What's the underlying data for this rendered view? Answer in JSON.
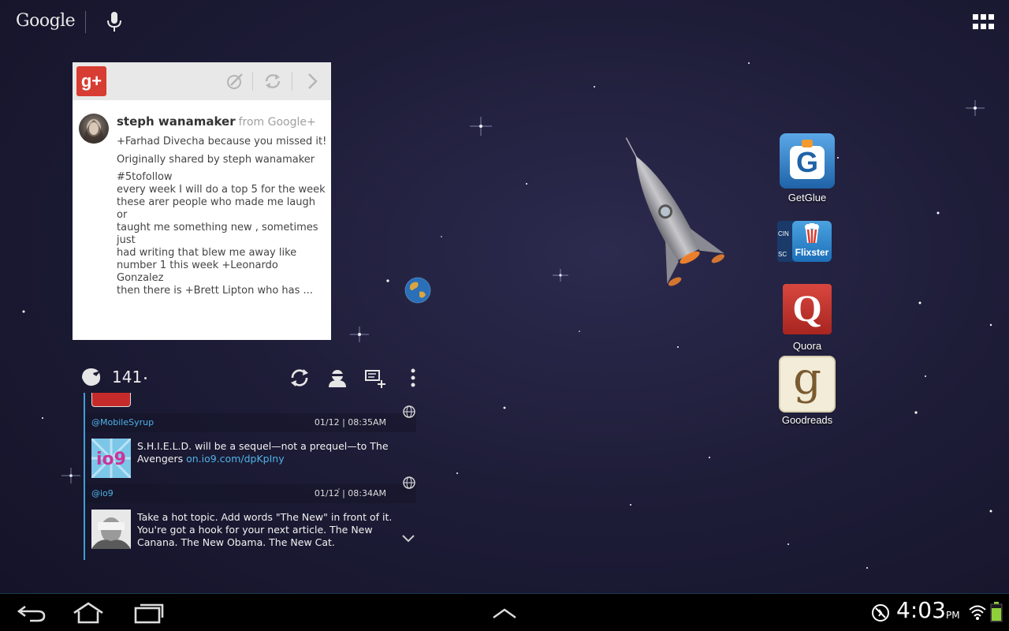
{
  "search_bar": {
    "logo_text": "Google"
  },
  "gplus_widget": {
    "logo_text": "g+",
    "author": "steph wanamaker",
    "source": "from Google+",
    "mention_line": "+Farhad Divecha because you missed it!",
    "shared_line": "Originally shared by steph wanamaker",
    "body": "#5tofollow\nevery  week I will do a  top 5 for the week\n these arer people who made me laugh or\ntaught me something new , sometimes just\nhad writing that blew me away  like\n number 1 this week  +Leonardo Gonzalez\nthen there is +Brett Lipton  who has ..."
  },
  "twitter_widget": {
    "count": "141",
    "tweets": [
      {
        "handle": "@MobileSyrup",
        "time": "01/12 | 08:35AM",
        "avatar_text": "io9",
        "text": "S.H.I.E.L.D. will be a sequel—not a prequel—to The Avengers ",
        "link": "on.io9.com/dpKpIny"
      },
      {
        "handle": "@io9",
        "time": "01/12 | 08:34AM",
        "text": "Take a hot topic. Add words \"The New\" in front of it. You're got a hook for your next article. The New Canana. The New Obama. The New Cat."
      }
    ]
  },
  "apps": [
    {
      "label": "GetGlue",
      "icon_text": "G"
    },
    {
      "label": "",
      "icon_text": "Flixster",
      "side_text_top": "CIN",
      "side_text_bottom": "SC"
    },
    {
      "label": "Quora",
      "icon_text": "Q"
    },
    {
      "label": "Goodreads",
      "icon_text": "g"
    }
  ],
  "status_bar": {
    "time": "4:03",
    "ampm": "PM"
  },
  "colors": {
    "gplus_red": "#d73d32",
    "twitter_blue": "#4fb3e8",
    "getglue_blue": "#2f7fc4",
    "quora_red": "#b92b27"
  }
}
